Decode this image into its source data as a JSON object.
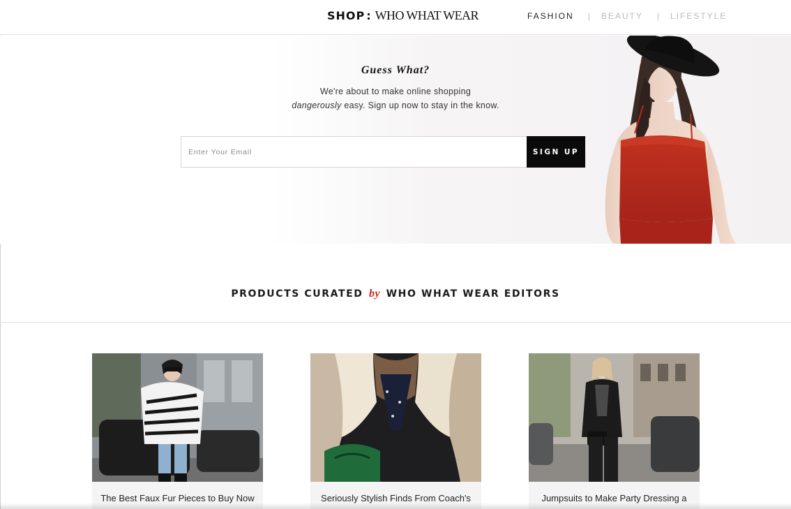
{
  "header": {
    "logo_shop": "SHOP",
    "logo_colon": ":",
    "logo_brand": "WHO WHAT WEAR",
    "nav": [
      {
        "label": "FASHION",
        "active": true
      },
      {
        "label": "BEAUTY",
        "active": false
      },
      {
        "label": "LIFESTYLE",
        "active": false
      }
    ],
    "nav_separator": "|"
  },
  "hero": {
    "heading": "Guess What?",
    "line1": "We're about to make online shopping",
    "line2_em": "dangerously",
    "line2_rest": " easy. Sign up now to stay in the know.",
    "email_placeholder": "Enter Your Email",
    "signup_label": "SIGN UP"
  },
  "section": {
    "title_pre": "PRODUCTS CURATED",
    "title_by": "by",
    "title_post": "WHO WHAT WEAR EDITORS"
  },
  "products": [
    {
      "caption": "The Best Faux Fur Pieces to Buy Now"
    },
    {
      "caption": "Seriously Stylish Finds From Coach's"
    },
    {
      "caption": "Jumpsuits to Make Party Dressing a"
    }
  ],
  "colors": {
    "accent_red": "#c8281e",
    "button_black": "#0a0a0a",
    "dress_red": "#b52a1c"
  }
}
